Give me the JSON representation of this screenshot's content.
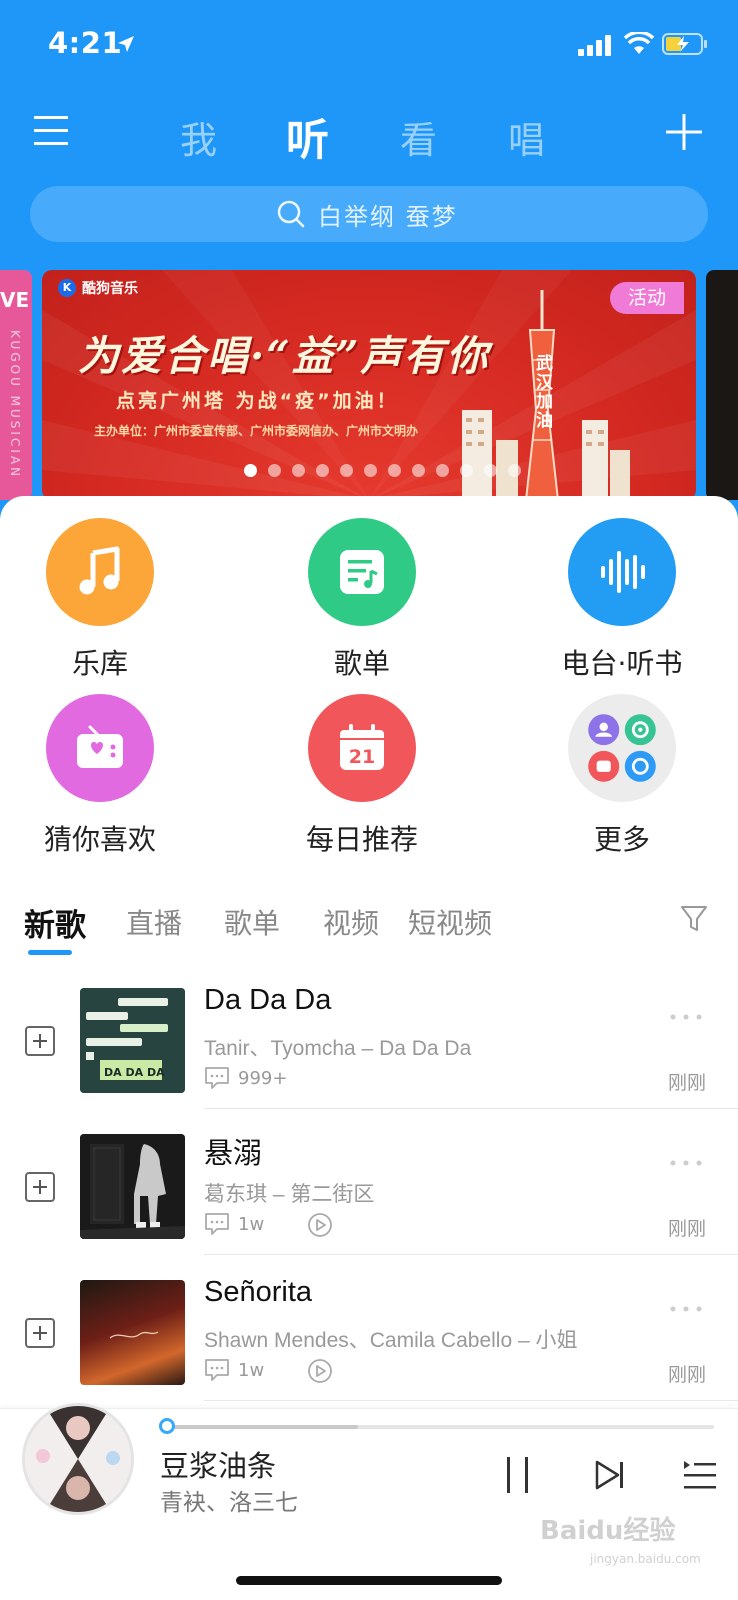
{
  "status_bar": {
    "time": "4:21"
  },
  "nav": {
    "tabs": [
      {
        "label": "我",
        "active": false
      },
      {
        "label": "听",
        "active": true
      },
      {
        "label": "看",
        "active": false
      },
      {
        "label": "唱",
        "active": false
      }
    ]
  },
  "search": {
    "placeholder": "白举纲  蚕梦"
  },
  "banner": {
    "logo_text": "酷狗音乐",
    "logo_letter": "K",
    "title": "为爱合唱·“益”声有你",
    "subtitle": "点亮广州塔 为战“疫”加油！",
    "organizers": "主办单位：广州市委宣传部、广州市委网信办、广州市文明办",
    "badge": "活动",
    "tower_text": "武汉加油",
    "slide_count": 12,
    "active_slide": 0,
    "left_card_text": "VE",
    "left_card_vertical": "KUGOU MUSICIAN"
  },
  "quick_access": [
    {
      "label": "乐库",
      "icon": "music-note-icon",
      "color": "#fca63a"
    },
    {
      "label": "歌单",
      "icon": "playlist-note-icon",
      "color": "#2fcb86"
    },
    {
      "label": "电台·听书",
      "icon": "sound-wave-icon",
      "color": "#239cf4"
    },
    {
      "label": "猜你喜欢",
      "icon": "radio-heart-icon",
      "color": "#e26ae0"
    },
    {
      "label": "每日推荐",
      "icon": "calendar-icon",
      "color": "#f0565a"
    },
    {
      "label": "更多",
      "icon": "more-apps-icon",
      "color": "#ececec"
    }
  ],
  "daily_date": "21",
  "content_tabs": [
    {
      "label": "新歌",
      "active": true
    },
    {
      "label": "直播",
      "active": false
    },
    {
      "label": "歌单",
      "active": false
    },
    {
      "label": "视频",
      "active": false
    },
    {
      "label": "短视频",
      "active": false
    }
  ],
  "songs": [
    {
      "title": "Da Da Da",
      "artist": "Tanir、Tyomcha – Da Da Da",
      "comments": "999+",
      "has_mv": false,
      "time": "刚刚",
      "cover_text": "DA DA DA"
    },
    {
      "title": "悬溺",
      "artist": "葛东琪 – 第二街区",
      "comments": "1w",
      "has_mv": true,
      "time": "刚刚"
    },
    {
      "title": "Señorita",
      "artist": "Shawn Mendes、Camila Cabello – 小姐",
      "comments": "1w",
      "has_mv": true,
      "time": "刚刚"
    }
  ],
  "player": {
    "title": "豆浆油条",
    "artist": "青袂、洛三七",
    "progress": 0.35
  },
  "watermark": {
    "text": "Baidu经验",
    "sub": "jingyan.baidu.com"
  }
}
